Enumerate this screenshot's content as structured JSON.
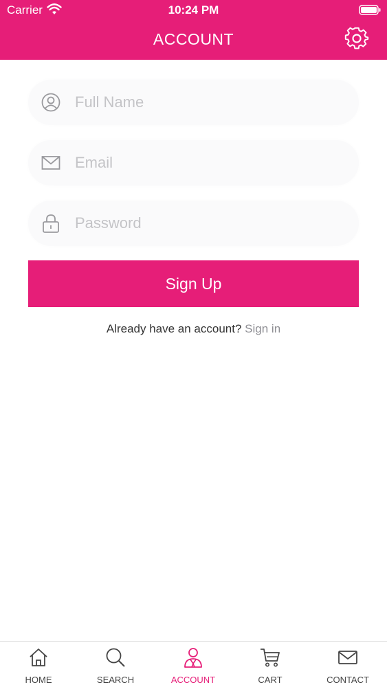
{
  "status_bar": {
    "carrier": "Carrier",
    "time": "10:24 PM",
    "wifi_icon": "wifi-icon",
    "battery_icon": "battery-icon"
  },
  "header": {
    "title": "ACCOUNT",
    "settings_icon": "gear-icon"
  },
  "form": {
    "full_name": {
      "placeholder": "Full Name",
      "value": "",
      "icon": "user-circle-icon"
    },
    "email": {
      "placeholder": "Email",
      "value": "",
      "icon": "envelope-icon"
    },
    "password": {
      "placeholder": "Password",
      "value": "",
      "icon": "lock-icon"
    },
    "submit_label": "Sign Up"
  },
  "signin": {
    "prompt": "Already have an account?",
    "link": "Sign in"
  },
  "tabs": [
    {
      "label": "HOME",
      "icon": "home-icon",
      "active": false
    },
    {
      "label": "SEARCH",
      "icon": "search-icon",
      "active": false
    },
    {
      "label": "ACCOUNT",
      "icon": "account-icon",
      "active": true
    },
    {
      "label": "CART",
      "icon": "cart-icon",
      "active": false
    },
    {
      "label": "CONTACT",
      "icon": "mail-icon",
      "active": false
    }
  ],
  "colors": {
    "accent": "#e61e78",
    "field_background": "#fafafb",
    "placeholder": "#c4c4c7",
    "link": "#8e8e93"
  }
}
